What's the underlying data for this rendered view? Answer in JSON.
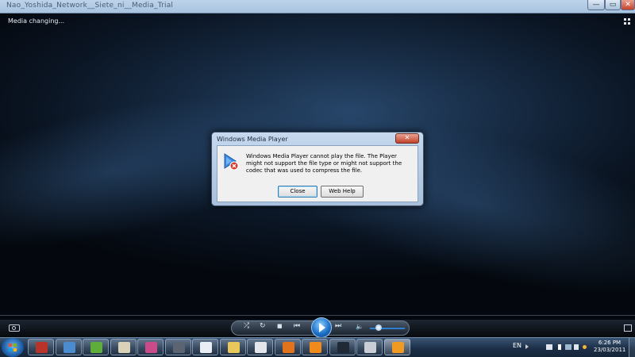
{
  "window": {
    "title": "Nao_Yoshida_Network__Siete_ni__Media_Trial",
    "min_glyph": "—",
    "max_glyph": "▭",
    "close_glyph": "✕"
  },
  "player": {
    "status": "Media changing..."
  },
  "dialog": {
    "title": "Windows Media Player",
    "close_glyph": "✕",
    "icon": "media-error-icon",
    "message": "Windows Media Player cannot play the file. The Player might not support the file type or might not support the codec that was used to compress the file.",
    "close_button": "Close",
    "help_button": "Web Help"
  },
  "controls": {
    "shuffle_glyph": "⤮",
    "repeat_glyph": "↻",
    "stop_glyph": "■",
    "prev_glyph": "⏮",
    "next_glyph": "⏭",
    "volume_glyph": "🔈",
    "volume_level": 0.25
  },
  "taskbar": {
    "language": "EN",
    "time": "6:26 PM",
    "date": "23/03/2011",
    "apps": [
      {
        "name": "firefox-style-icon",
        "color": "#b8342b"
      },
      {
        "name": "computer-icon",
        "color": "#4a8ccf"
      },
      {
        "name": "messenger-icon",
        "color": "#5fae3b"
      },
      {
        "name": "paint-icon",
        "color": "#d9d2b8"
      },
      {
        "name": "search-icon",
        "color": "#c94b8a"
      },
      {
        "name": "film-icon",
        "color": "#5b6470"
      },
      {
        "name": "runner-icon",
        "color": "#e9eef5"
      },
      {
        "name": "folder-icon",
        "color": "#e8c85a"
      },
      {
        "name": "notes-icon",
        "color": "#e3e7ec"
      },
      {
        "name": "firefox-icon",
        "color": "#e0731c"
      },
      {
        "name": "vlc-icon",
        "color": "#f08a1c"
      },
      {
        "name": "movie-maker-icon",
        "color": "#202a36"
      },
      {
        "name": "clapper-icon",
        "color": "#c9ced6"
      },
      {
        "name": "media-player-icon",
        "color": "#f09a24"
      }
    ]
  }
}
